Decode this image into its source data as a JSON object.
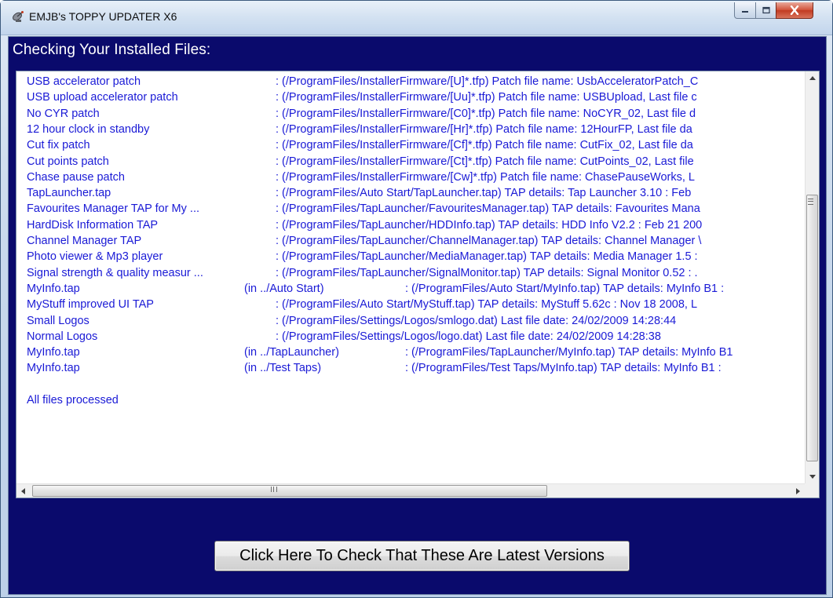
{
  "window": {
    "title": "EMJB's TOPPY UPDATER X6",
    "controls": {
      "minimize": "minimize-icon",
      "maximize": "maximize-icon",
      "close": "close-icon"
    }
  },
  "header": {
    "title": "Checking Your Installed Files:"
  },
  "list": {
    "rows": [
      {
        "name": "USB accelerator patch",
        "location": "",
        "detail": ": (/ProgramFiles/InstallerFirmware/[U]*.tfp) Patch file name: UsbAcceleratorPatch_C"
      },
      {
        "name": "USB upload accelerator patch",
        "location": "",
        "detail": ": (/ProgramFiles/InstallerFirmware/[Uu]*.tfp) Patch file name: USBUpload, Last file c"
      },
      {
        "name": "No CYR patch",
        "location": "",
        "detail": ": (/ProgramFiles/InstallerFirmware/[C0]*.tfp) Patch file name: NoCYR_02, Last file d"
      },
      {
        "name": "12 hour clock in standby",
        "location": "",
        "detail": ": (/ProgramFiles/InstallerFirmware/[Hr]*.tfp) Patch file name: 12HourFP, Last file da"
      },
      {
        "name": "Cut fix patch",
        "location": "",
        "detail": ": (/ProgramFiles/InstallerFirmware/[Cf]*.tfp) Patch file name: CutFix_02, Last file da"
      },
      {
        "name": "Cut points patch",
        "location": "",
        "detail": ": (/ProgramFiles/InstallerFirmware/[Ct]*.tfp) Patch file name: CutPoints_02, Last file"
      },
      {
        "name": "Chase pause patch",
        "location": "",
        "detail": ": (/ProgramFiles/InstallerFirmware/[Cw]*.tfp) Patch file name: ChasePauseWorks, L"
      },
      {
        "name": "TapLauncher.tap",
        "location": "",
        "detail": ": (/ProgramFiles/Auto Start/TapLauncher.tap) TAP details: Tap Launcher 3.10 : Feb"
      },
      {
        "name": "Favourites Manager TAP for My ...",
        "location": "",
        "detail": ": (/ProgramFiles/TapLauncher/FavouritesManager.tap) TAP details: Favourites Mana"
      },
      {
        "name": "HardDisk Information TAP",
        "location": "",
        "detail": ": (/ProgramFiles/TapLauncher/HDDInfo.tap) TAP details: HDD Info V2.2 : Feb 21 200"
      },
      {
        "name": "Channel Manager TAP",
        "location": "",
        "detail": ": (/ProgramFiles/TapLauncher/ChannelManager.tap) TAP details: Channel Manager \\"
      },
      {
        "name": "Photo viewer & Mp3 player",
        "location": "",
        "detail": ": (/ProgramFiles/TapLauncher/MediaManager.tap) TAP details: Media Manager 1.5 :"
      },
      {
        "name": "Signal strength & quality measur ...",
        "location": "",
        "detail": ": (/ProgramFiles/TapLauncher/SignalMonitor.tap) TAP details: Signal Monitor 0.52 : ."
      },
      {
        "name": "MyInfo.tap",
        "location": "(in ../Auto Start)",
        "detail": ": (/ProgramFiles/Auto Start/MyInfo.tap) TAP details: MyInfo B1 :"
      },
      {
        "name": "MyStuff improved UI TAP",
        "location": "",
        "detail": ": (/ProgramFiles/Auto Start/MyStuff.tap) TAP details: MyStuff 5.62c : Nov 18 2008, L"
      },
      {
        "name": "Small Logos",
        "location": "",
        "detail": ": (/ProgramFiles/Settings/Logos/smlogo.dat) Last file date: 24/02/2009 14:28:44"
      },
      {
        "name": "Normal Logos",
        "location": "",
        "detail": ": (/ProgramFiles/Settings/Logos/logo.dat) Last file date: 24/02/2009 14:28:38"
      },
      {
        "name": "MyInfo.tap",
        "location": "(in ../TapLauncher)",
        "detail": ": (/ProgramFiles/TapLauncher/MyInfo.tap) TAP details: MyInfo B1"
      },
      {
        "name": "MyInfo.tap",
        "location": "(in ../Test Taps)",
        "detail": ": (/ProgramFiles/Test Taps/MyInfo.tap) TAP details: MyInfo B1 :"
      }
    ],
    "status": "All files processed"
  },
  "scrollbar": {
    "horizontal_grip": "III",
    "vertical_grip": "≡"
  },
  "actions": {
    "check_button_label": "Click Here To Check That These Are Latest Versions"
  },
  "colors": {
    "client_background": "#0a0a6c",
    "list_text": "#1a1ad6",
    "header_text": "#ffffff"
  }
}
